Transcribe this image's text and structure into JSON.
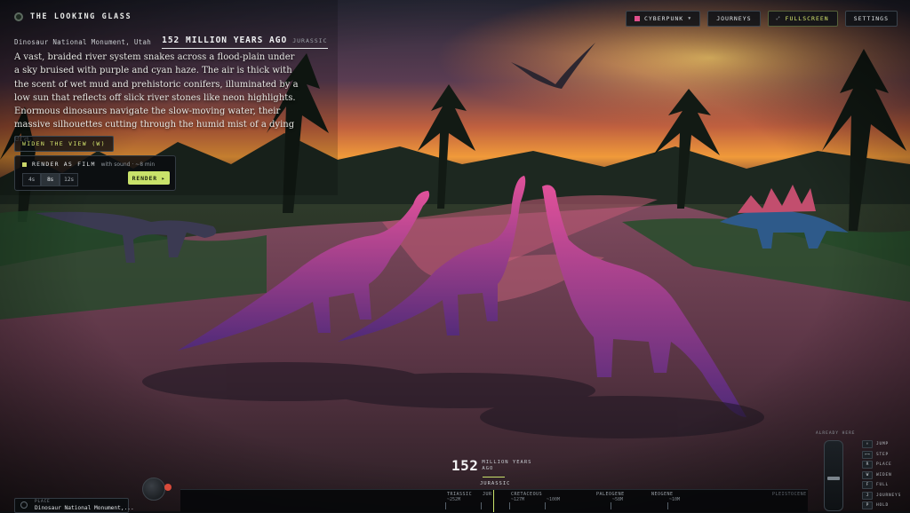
{
  "app": {
    "title": "THE LOOKING GLASS"
  },
  "location": {
    "name": "Dinosaur National Monument, Utah",
    "years_ago": "152 MILLION YEARS AGO",
    "period": "JURASSIC"
  },
  "narration": "A vast, braided river system snakes across a flood-plain under a sky bruised with purple and cyan haze. The air is thick with the scent of wet mud and prehistoric conifers, illuminated by a low sun that reflects off slick river stones like neon highlights. Enormous dinosaurs navigate the slow-moving water, their massive silhouettes cutting through the humid mist of a dying era.",
  "actions": {
    "widen_label": "WIDEN THE VIEW (W)"
  },
  "film": {
    "title": "RENDER AS FILM",
    "subtitle": "with sound · ~8 min",
    "durations": [
      "4s",
      "8s",
      "12s"
    ],
    "selected": "8s",
    "render_label": "RENDER ▸"
  },
  "toolbar": {
    "style_label": "CYBERPUNK",
    "style_color": "#e04f8c",
    "journeys_label": "JOURNEYS",
    "fullscreen_label": "FULLSCREEN",
    "settings_label": "SETTINGS"
  },
  "readout": {
    "year_number": "152",
    "year_unit": "MILLION YEARS AGO",
    "period": "JURASSIC"
  },
  "timeline": {
    "ticks": [
      {
        "label": "TRIASSIC",
        "value": "~252M"
      },
      {
        "label": "JUR",
        "value": ""
      },
      {
        "label": "CRETACEOUS",
        "value": "~127M"
      },
      {
        "label": "",
        "value": "~100M"
      },
      {
        "label": "PALEOGENE",
        "value": "~58M"
      },
      {
        "label": "NEOGENE",
        "value": "~10M"
      },
      {
        "label": "PLEISTOCENE",
        "value": ""
      }
    ]
  },
  "place": {
    "label": "PLACE",
    "name": "Dinosaur National Monument,..."
  },
  "already_here_label": "ALREADY HERE",
  "keys": [
    {
      "key": "↑",
      "label": "JUMP"
    },
    {
      "key": "←→",
      "label": "STEP"
    },
    {
      "key": "R",
      "label": "PLACE"
    },
    {
      "key": "W",
      "label": "WIDEN"
    },
    {
      "key": "F",
      "label": "FULL"
    },
    {
      "key": "J",
      "label": "JOURNEYS"
    },
    {
      "key": "P",
      "label": "HOLD"
    }
  ]
}
